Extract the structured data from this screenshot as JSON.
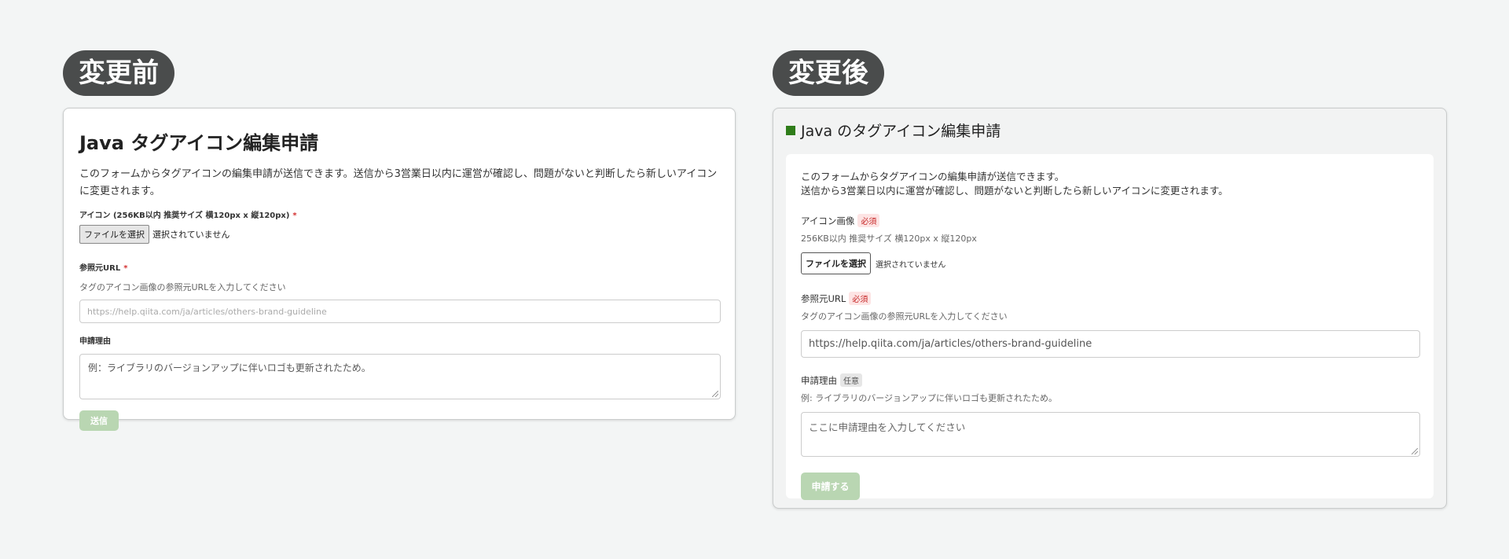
{
  "before": {
    "pill_label": "変更前",
    "title": "Java タグアイコン編集申請",
    "description": "このフォームからタグアイコンの編集申請が送信できます。送信から3営業日以内に運営が確認し、問題がないと判断したら新しいアイコンに変更されます。",
    "icon_label": "アイコン (256KB以内 推奨サイズ 横120px x 縦120px)",
    "required_mark": "*",
    "file_button": "ファイルを選択",
    "file_status": "選択されていません",
    "url_label": "参照元URL",
    "url_help": "タグのアイコン画像の参照元URLを入力してください",
    "url_placeholder": "https://help.qiita.com/ja/articles/others-brand-guideline",
    "reason_label": "申請理由",
    "reason_placeholder": "例：ライブラリのバージョンアップに伴いロゴも更新されたため。",
    "submit_label": "送信"
  },
  "after": {
    "pill_label": "変更後",
    "title": "Java のタグアイコン編集申請",
    "description_line1": "このフォームからタグアイコンの編集申請が送信できます。",
    "description_line2": "送信から3営業日以内に運営が確認し、問題がないと判断したら新しいアイコンに変更されます。",
    "icon_label": "アイコン画像",
    "required_badge": "必須",
    "icon_help": "256KB以内 推奨サイズ 横120px x 縦120px",
    "file_button": "ファイルを選択",
    "file_status": "選択されていません",
    "url_label": "参照元URL",
    "url_help": "タグのアイコン画像の参照元URLを入力してください",
    "url_placeholder": "https://help.qiita.com/ja/articles/others-brand-guideline",
    "reason_label": "申請理由",
    "optional_badge": "任意",
    "reason_help": "例: ライブラリのバージョンアップに伴いロゴも更新されたため。",
    "reason_placeholder": "ここに申請理由を入力してください",
    "submit_label": "申請する"
  },
  "colors": {
    "accent_green": "#2f7d1a",
    "submit_disabled": "#b9d6b2",
    "required_red": "#c62828",
    "pill_bg": "#4a4c4c"
  }
}
